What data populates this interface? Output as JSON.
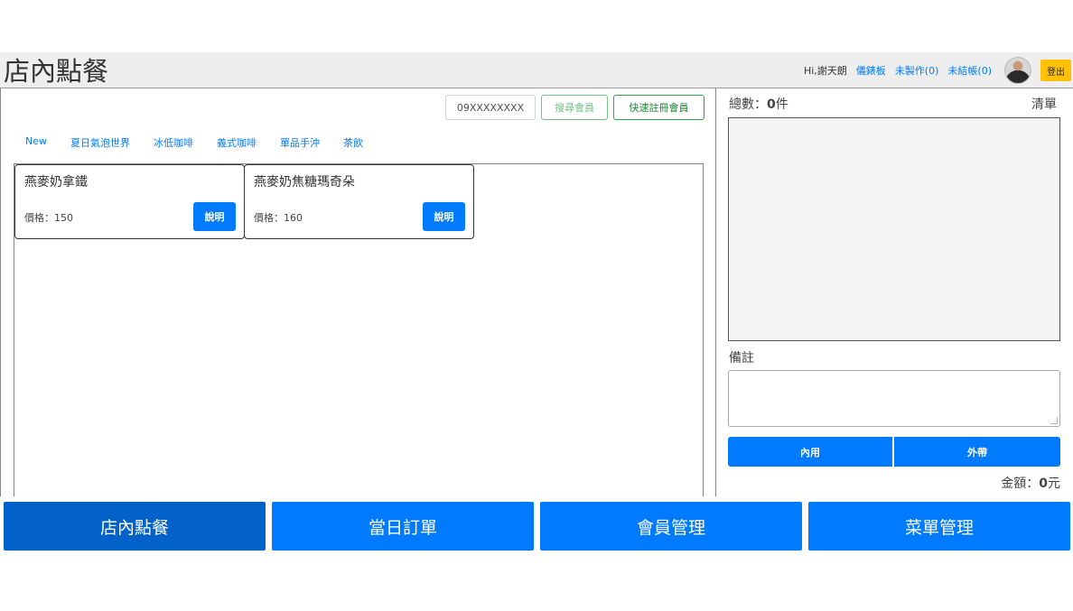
{
  "header": {
    "title": "店內點餐",
    "greeting": "Hi,謝天朗",
    "dashboard": "儀錶板",
    "unmade": "未製作(0)",
    "unpaid": "未結帳(0)",
    "logout": "登出"
  },
  "member": {
    "phone_value": "09XXXXXXXX",
    "search_button": "搜尋會員",
    "register_button": "快速註冊會員"
  },
  "categories": [
    "New",
    "夏日氣泡世界",
    "冰低咖啡",
    "義式咖啡",
    "單品手沖",
    "茶飲"
  ],
  "menu_items": [
    {
      "name": "燕麥奶拿鐵",
      "price": "價格：150",
      "button": "說明"
    },
    {
      "name": "燕麥奶焦糖瑪奇朵",
      "price": "價格：160",
      "button": "說明"
    }
  ],
  "order": {
    "count_prefix": "總數：",
    "count": "0",
    "count_suffix": "件",
    "clear": "清單",
    "notes_label": "備註",
    "dine_in": "內用",
    "take_out": "外帶",
    "amount_prefix": "金額：",
    "amount": "0",
    "amount_suffix": "元"
  },
  "bottom_nav": [
    "店內點餐",
    "當日訂單",
    "會員管理",
    "菜單管理"
  ],
  "colors": {
    "primary": "#007bff",
    "active_nav": "#0262c9",
    "success": "#28a745",
    "warning": "#ffc107"
  }
}
